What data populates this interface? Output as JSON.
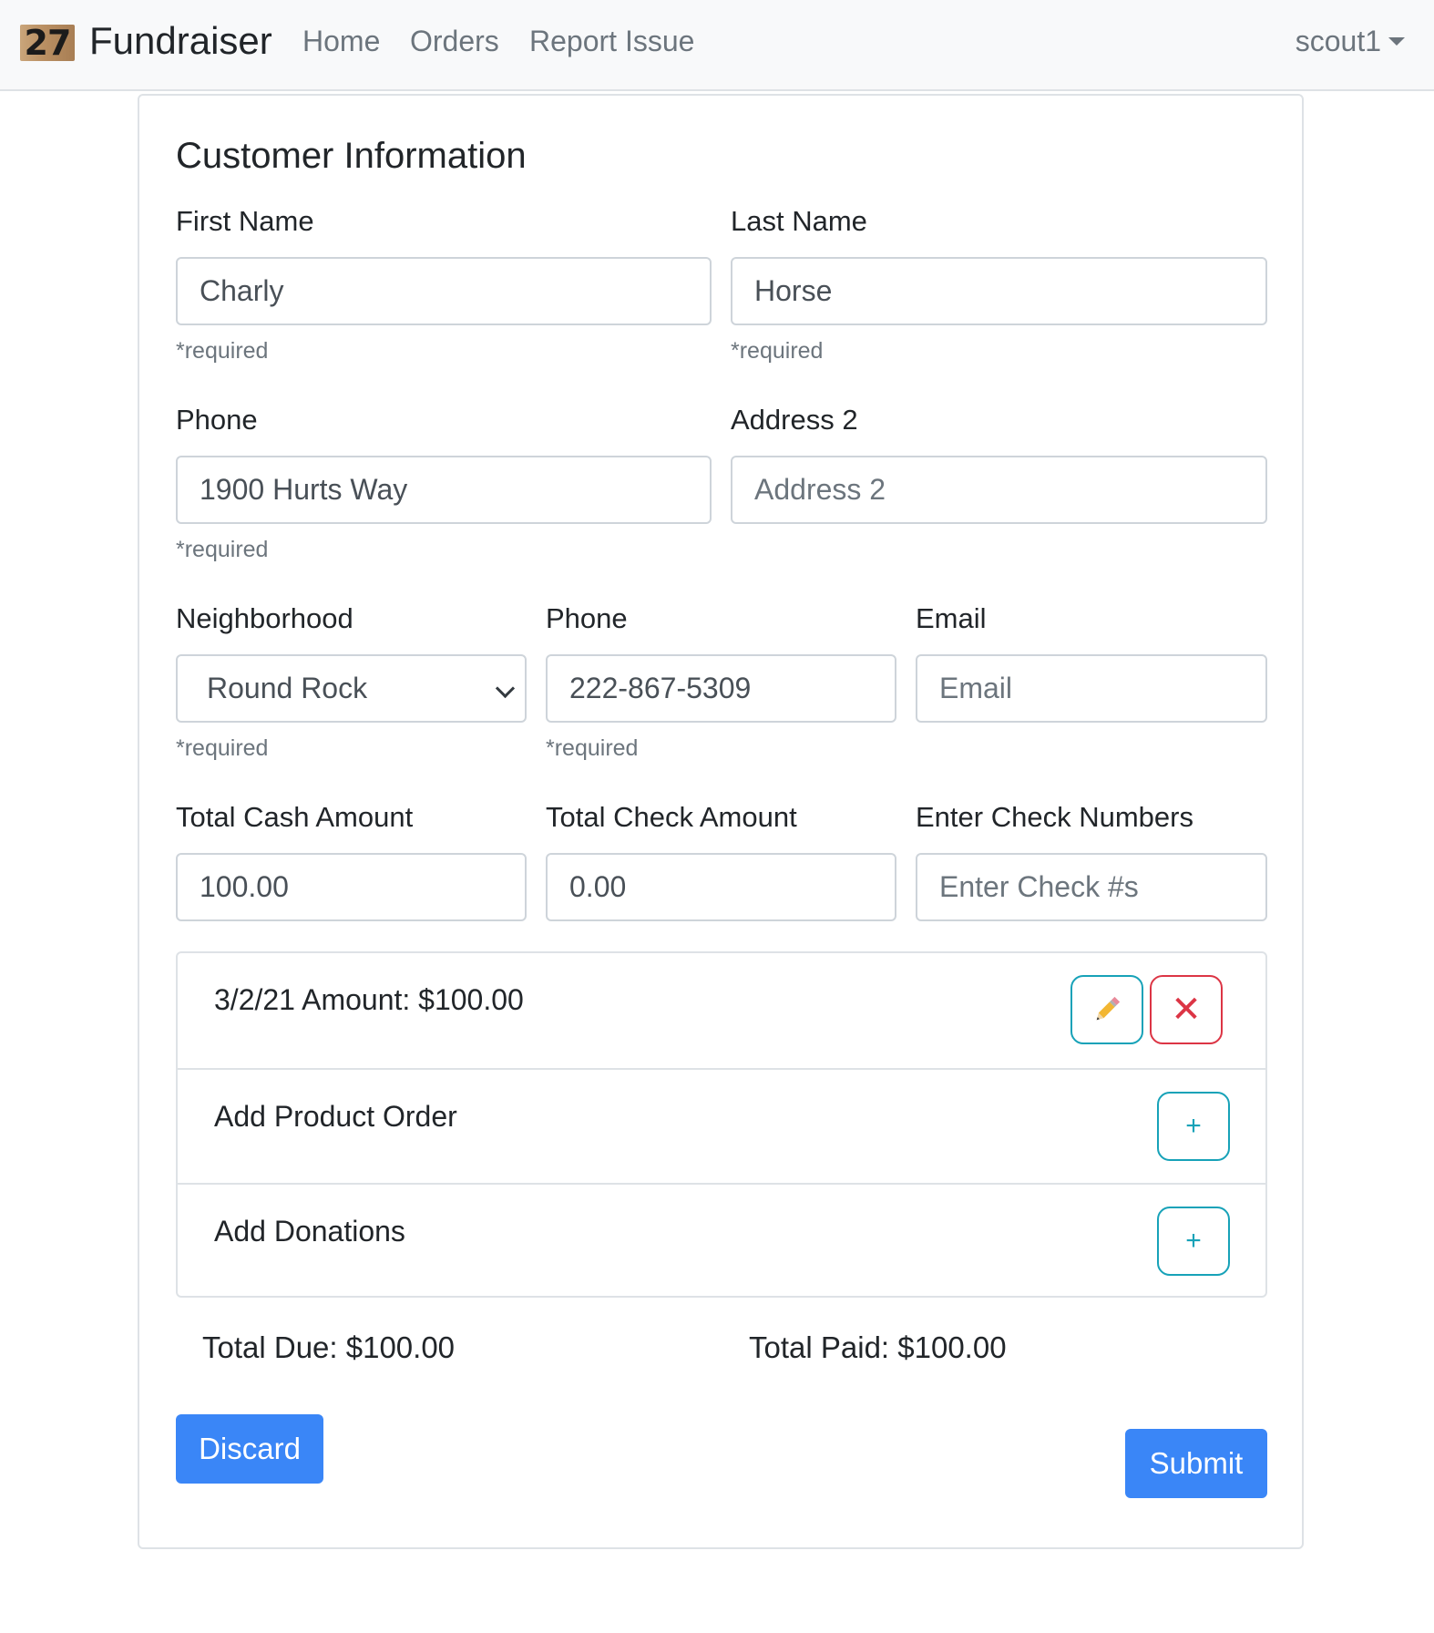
{
  "navbar": {
    "logo_text": "27",
    "brand": "Fundraiser",
    "links": [
      "Home",
      "Orders",
      "Report Issue"
    ],
    "user": "scout1"
  },
  "form": {
    "title": "Customer Information",
    "first_name": {
      "label": "First Name",
      "value": "Charly",
      "help": "*required"
    },
    "last_name": {
      "label": "Last Name",
      "value": "Horse",
      "help": "*required"
    },
    "address1": {
      "label": "Phone",
      "value": "1900 Hurts Way",
      "help": "*required"
    },
    "address2": {
      "label": "Address 2",
      "placeholder": "Address 2"
    },
    "neighborhood": {
      "label": "Neighborhood",
      "selected": "Round Rock",
      "help": "*required"
    },
    "phone": {
      "label": "Phone",
      "value": "222-867-5309",
      "help": "*required"
    },
    "email": {
      "label": "Email",
      "placeholder": "Email"
    },
    "cash": {
      "label": "Total Cash Amount",
      "value": "100.00"
    },
    "check": {
      "label": "Total Check Amount",
      "value": "0.00"
    },
    "check_numbers": {
      "label": "Enter Check Numbers",
      "placeholder": "Enter Check #s"
    }
  },
  "orders": {
    "items": [
      {
        "text": "3/2/21 Amount: $100.00"
      },
      {
        "text": "Add Product Order"
      },
      {
        "text": "Add Donations"
      }
    ],
    "icons": {
      "edit": "pencil-icon",
      "delete": "close-icon",
      "add": "plus-icon"
    },
    "add_glyph": "+",
    "delete_glyph": "✕"
  },
  "totals": {
    "due": "Total Due: $100.00",
    "paid": "Total Paid: $100.00"
  },
  "actions": {
    "discard": "Discard",
    "submit": "Submit"
  },
  "colors": {
    "primary": "#3a86f7",
    "info": "#17a2b8",
    "danger": "#dc3545",
    "muted": "#6c757d"
  }
}
